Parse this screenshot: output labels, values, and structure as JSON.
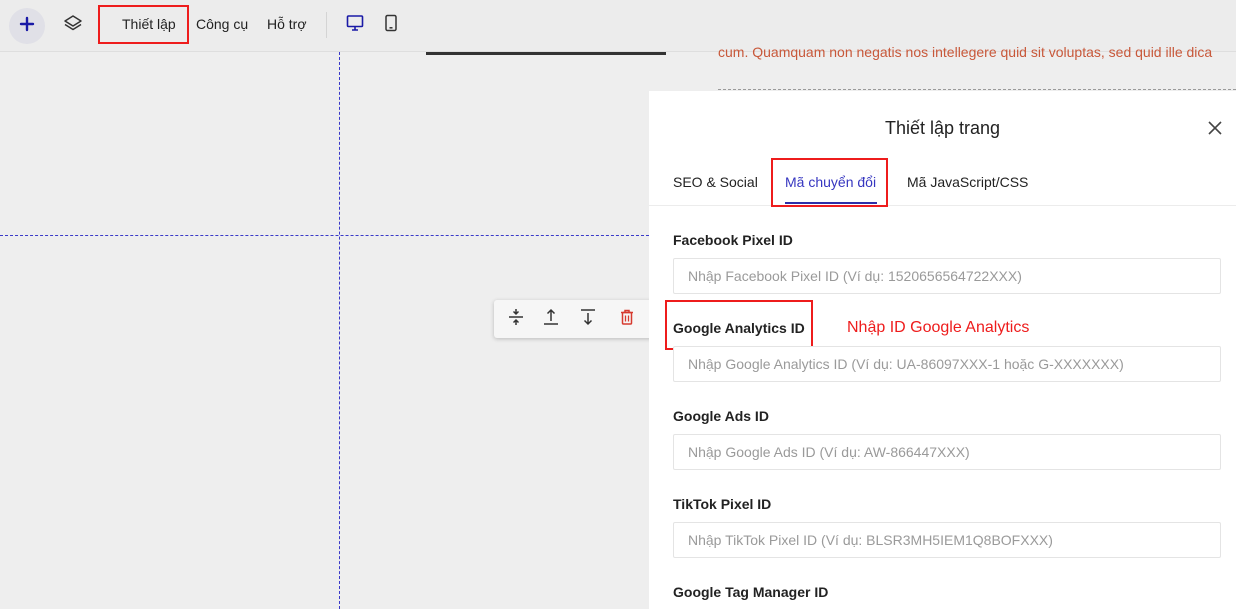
{
  "toolbar": {
    "add_icon": "plus-icon",
    "layers_icon": "layers-icon",
    "menu": [
      "Thiết lập",
      "Công cụ",
      "Hỗ trợ"
    ],
    "desktop_icon": "desktop-icon",
    "mobile_icon": "mobile-icon",
    "accent_color": "#1a1aa6"
  },
  "canvas": {
    "background_text": "cum. Quamquam non negatis nos intellegere quid sit voluptas, sed quid ille dica",
    "float_toolbar": [
      "move-vertical-icon",
      "align-top-icon",
      "align-bottom-icon",
      "trash-icon"
    ],
    "guide_color": "#3a3ac8"
  },
  "panel": {
    "title": "Thiết lập trang",
    "close_icon": "close-icon",
    "tabs": [
      {
        "label": "SEO & Social"
      },
      {
        "label": "Mã chuyển đổi",
        "active": true
      },
      {
        "label": "Mã JavaScript/CSS"
      }
    ],
    "fields": [
      {
        "label": "Facebook Pixel ID",
        "value": "",
        "placeholder": "Nhập Facebook Pixel ID (Ví dụ: 1520656564722XXX)"
      },
      {
        "label": "Google Analytics ID",
        "value": "",
        "placeholder": "Nhập Google Analytics ID (Ví dụ: UA-86097XXX-1 hoặc G-XXXXXXX)"
      },
      {
        "label": "Google Ads ID",
        "value": "",
        "placeholder": "Nhập Google Ads ID (Ví dụ: AW-866447XXX)"
      },
      {
        "label": "TikTok Pixel ID",
        "value": "",
        "placeholder": "Nhập TikTok Pixel ID (Ví dụ: BLSR3MH5IEM1Q8BOFXXX)"
      },
      {
        "label": "Google Tag Manager ID"
      }
    ]
  },
  "annotation": {
    "text": "Nhập ID Google Analytics",
    "color": "#ee1c1c"
  }
}
